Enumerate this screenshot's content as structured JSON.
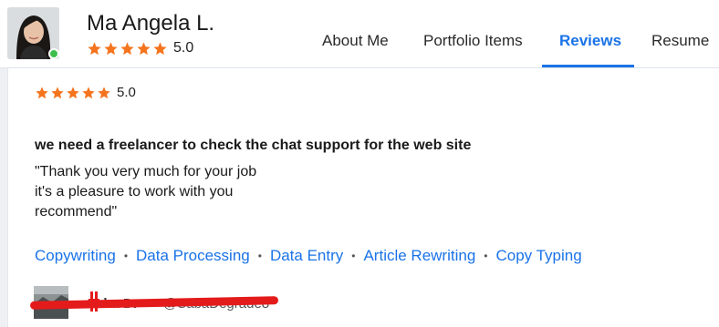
{
  "profile": {
    "name": "Ma Angela L.",
    "rating": "5.0",
    "stars": 5,
    "online": true
  },
  "nav": {
    "tabs": [
      {
        "label": "About Me"
      },
      {
        "label": "Portfolio Items"
      },
      {
        "label": "Reviews"
      },
      {
        "label": "Resume"
      }
    ],
    "active_tab": "Reviews"
  },
  "review": {
    "rating": "5.0",
    "stars": 5,
    "title": "we need a freelancer to check the chat support for the web site",
    "body_lines": [
      "\"Thank you very much for your job",
      "it's a pleasure to work with you",
      "recommend\""
    ],
    "skills": [
      "Copywriting",
      "Data Processing",
      "Data Entry",
      "Article Rewriting",
      "Copy Typing"
    ],
    "reviewer": {
      "name": "Saba D.",
      "handle": "@SabaDegrade8",
      "redacted": true
    }
  },
  "colors": {
    "accent": "#1a73e8",
    "star": "#f5741e",
    "online": "#3dbd4b",
    "redaction": "#e41b1b"
  }
}
